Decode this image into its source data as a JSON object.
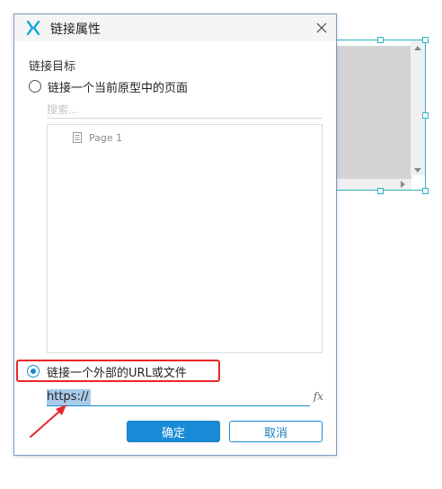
{
  "dialog": {
    "title": "链接属性",
    "section_label": "链接目标",
    "page_option": {
      "label": "链接一个当前原型中的页面",
      "selected": false
    },
    "search": {
      "placeholder": "搜索..."
    },
    "page_tree": {
      "items": [
        {
          "label": "Page 1",
          "icon": "page-icon"
        }
      ]
    },
    "url_option": {
      "label": "链接一个外部的URL或文件",
      "selected": true
    },
    "url_input": {
      "value": "https://"
    },
    "fx_label": "fx",
    "ok_label": "确定",
    "cancel_label": "取消"
  },
  "colors": {
    "accent": "#1a8bd6",
    "highlight_red": "#e8262c",
    "selection_blue": "#a9cbea",
    "widget_border": "#2fb2c4",
    "logo": "#1aa6d8"
  }
}
